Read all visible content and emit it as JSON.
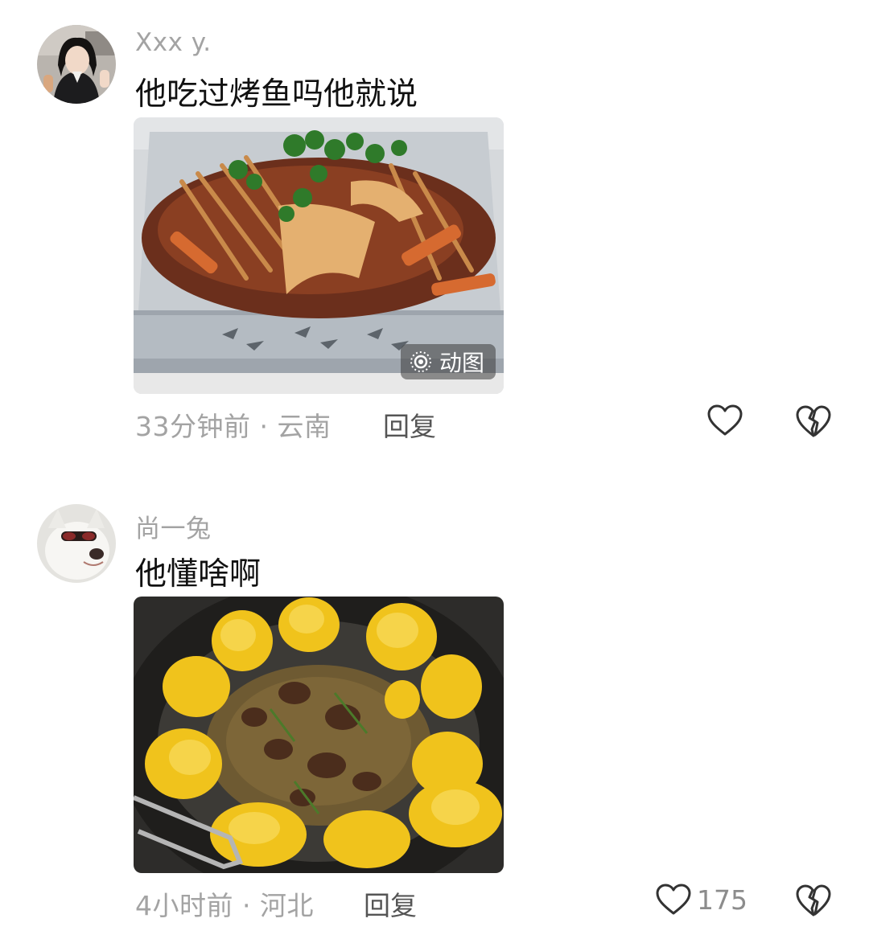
{
  "comments": [
    {
      "username": "Xxx y.",
      "text": "他吃过烤鱼吗他就说",
      "image_badge": "动图",
      "meta": "33分钟前 · 云南",
      "reply_label": "回复",
      "like_count": ""
    },
    {
      "username": "尚一兔",
      "text": "他懂啥啊",
      "meta": "4小时前 · 河北",
      "reply_label": "回复",
      "like_count": "175"
    }
  ],
  "icons": {
    "like": "heart-outline-icon",
    "dislike": "broken-heart-icon",
    "gif": "live-photo-icon"
  },
  "colors": {
    "meta_gray": "#a3a3a3",
    "reply_gray": "#555555",
    "text": "#111111"
  }
}
